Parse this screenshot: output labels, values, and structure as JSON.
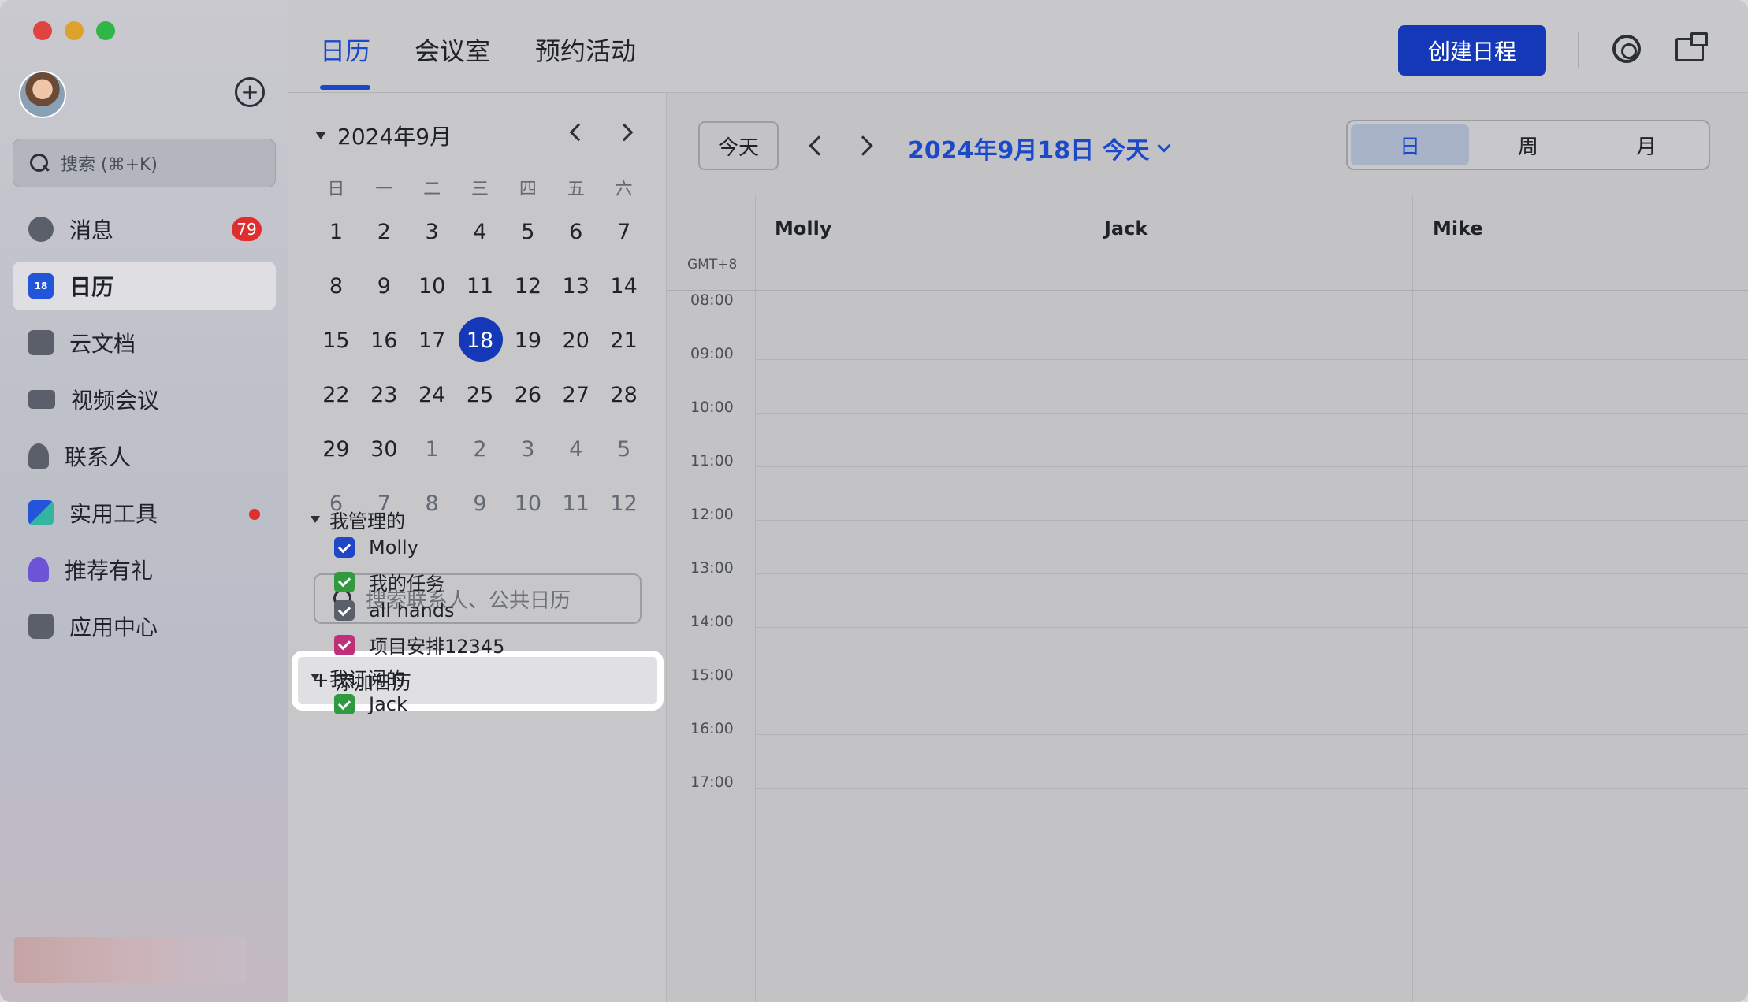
{
  "sidebar": {
    "search_placeholder": "搜索 (⌘+K)",
    "items": [
      {
        "label": "消息",
        "badge": "79"
      },
      {
        "label": "日历",
        "icon_text": "18"
      },
      {
        "label": "云文档"
      },
      {
        "label": "视频会议"
      },
      {
        "label": "联系人"
      },
      {
        "label": "实用工具"
      },
      {
        "label": "推荐有礼"
      },
      {
        "label": "应用中心"
      }
    ]
  },
  "topbar": {
    "tabs": [
      "日历",
      "会议室",
      "预约活动"
    ],
    "create_label": "创建日程"
  },
  "mini_calendar": {
    "month_label": "2024年9月",
    "weekdays": [
      "日",
      "一",
      "二",
      "三",
      "四",
      "五",
      "六"
    ],
    "weeks": [
      [
        "1",
        "2",
        "3",
        "4",
        "5",
        "6",
        "7"
      ],
      [
        "8",
        "9",
        "10",
        "11",
        "12",
        "13",
        "14"
      ],
      [
        "15",
        "16",
        "17",
        "18",
        "19",
        "20",
        "21"
      ],
      [
        "22",
        "23",
        "24",
        "25",
        "26",
        "27",
        "28"
      ],
      [
        "29",
        "30",
        "1",
        "2",
        "3",
        "4",
        "5"
      ],
      [
        "6",
        "7",
        "8",
        "9",
        "10",
        "11",
        "12"
      ]
    ],
    "selected_day": "18"
  },
  "calendars": {
    "search_placeholder": "搜索联系人、公共日历",
    "add_label": "添加日历",
    "managed_title": "我管理的",
    "managed": [
      {
        "label": "Molly",
        "color": "#1f46c4"
      },
      {
        "label": "我的任务",
        "color": "#2f9a3e"
      },
      {
        "label": "all hands",
        "color": "#5a5f69"
      },
      {
        "label": "项目安排12345",
        "color": "#c0307a"
      }
    ],
    "subscribed_title": "我订阅的",
    "subscribed": [
      {
        "label": "Jack",
        "color": "#2f9a3e"
      }
    ]
  },
  "dayview": {
    "today_label": "今天",
    "date_title": "2024年9月18日 今天",
    "views": [
      "日",
      "周",
      "月"
    ],
    "active_view": "日",
    "timezone": "GMT+8",
    "columns": [
      "Molly",
      "Jack",
      "Mike"
    ],
    "hours": [
      "08:00",
      "09:00",
      "10:00",
      "11:00",
      "12:00",
      "13:00",
      "14:00",
      "15:00",
      "16:00",
      "17:00"
    ]
  },
  "colors": {
    "accent": "#1b49c9",
    "primary_button": "#1438b8",
    "badge": "#e02e2e"
  }
}
